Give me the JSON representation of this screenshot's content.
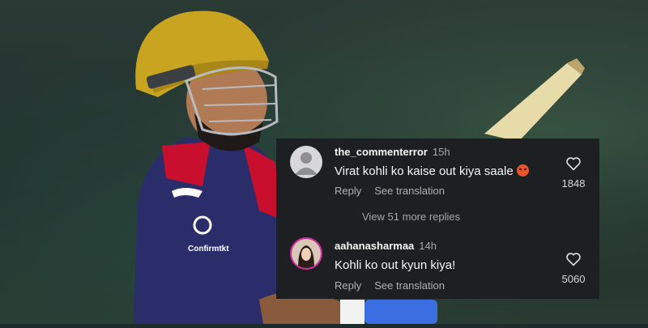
{
  "comments": [
    {
      "username": "the_commenterror",
      "time": "15h",
      "text": "Virat kohli ko kaise out kiya saale",
      "reply_label": "Reply",
      "translate_label": "See translation",
      "likes": "1848",
      "avatar_icon": "default-avatar-icon",
      "emoji_icon": "angry-face-emoji"
    },
    {
      "username": "aahanasharmaa",
      "time": "14h",
      "text": "Kohli ko out kyun kiya!",
      "reply_label": "Reply",
      "translate_label": "See translation",
      "likes": "5060",
      "avatar_icon": "profile-photo-avatar"
    }
  ],
  "view_more_label": "View 51 more replies",
  "like_icon": "heart-outline-icon",
  "colors": {
    "panel_bg": "#1e1f22",
    "text_primary": "#f5f5f5",
    "text_secondary": "#a8a8a8",
    "story_ring": "#d12ca0"
  }
}
